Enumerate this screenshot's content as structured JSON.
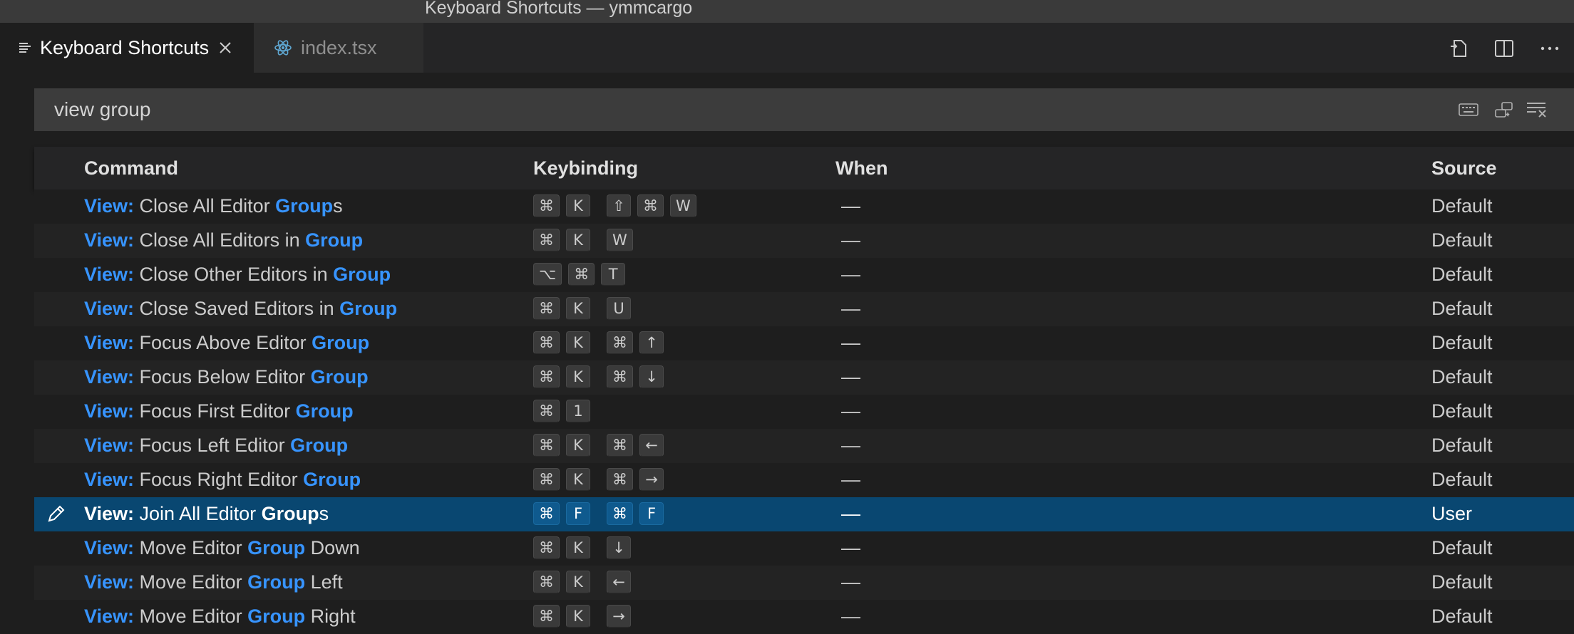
{
  "window": {
    "title": "Keyboard Shortcuts — ymmcargo"
  },
  "tabs": [
    {
      "label": "Keyboard Shortcuts",
      "active": true,
      "icon": "settings-list-icon"
    },
    {
      "label": "index.tsx",
      "active": false,
      "icon": "react-icon"
    }
  ],
  "toolbar_icons": [
    "open-keybindings-json-icon",
    "split-editor-icon",
    "more-actions-icon"
  ],
  "search": {
    "value": "view group",
    "actions": [
      "record-keys-icon",
      "sort-by-precedence-icon",
      "clear-input-icon"
    ]
  },
  "table": {
    "headers": {
      "command": "Command",
      "keybinding": "Keybinding",
      "when": "When",
      "source": "Source"
    },
    "rows": [
      {
        "prefix": "View:",
        "before": " Close All Editor ",
        "match": "Group",
        "after": "s",
        "keys": [
          [
            "⌘",
            "K"
          ],
          [
            "⇧",
            "⌘",
            "W"
          ]
        ],
        "when": "—",
        "source": "Default"
      },
      {
        "prefix": "View:",
        "before": " Close All Editors in ",
        "match": "Group",
        "after": "",
        "keys": [
          [
            "⌘",
            "K"
          ],
          [
            "W"
          ]
        ],
        "when": "—",
        "source": "Default"
      },
      {
        "prefix": "View:",
        "before": " Close Other Editors in ",
        "match": "Group",
        "after": "",
        "keys": [
          [
            "⌥",
            "⌘",
            "T"
          ]
        ],
        "when": "—",
        "source": "Default"
      },
      {
        "prefix": "View:",
        "before": " Close Saved Editors in ",
        "match": "Group",
        "after": "",
        "keys": [
          [
            "⌘",
            "K"
          ],
          [
            "U"
          ]
        ],
        "when": "—",
        "source": "Default"
      },
      {
        "prefix": "View:",
        "before": " Focus Above Editor ",
        "match": "Group",
        "after": "",
        "keys": [
          [
            "⌘",
            "K"
          ],
          [
            "⌘",
            "↑"
          ]
        ],
        "when": "—",
        "source": "Default"
      },
      {
        "prefix": "View:",
        "before": " Focus Below Editor ",
        "match": "Group",
        "after": "",
        "keys": [
          [
            "⌘",
            "K"
          ],
          [
            "⌘",
            "↓"
          ]
        ],
        "when": "—",
        "source": "Default"
      },
      {
        "prefix": "View:",
        "before": " Focus First Editor ",
        "match": "Group",
        "after": "",
        "keys": [
          [
            "⌘",
            "1"
          ]
        ],
        "when": "—",
        "source": "Default"
      },
      {
        "prefix": "View:",
        "before": " Focus Left Editor ",
        "match": "Group",
        "after": "",
        "keys": [
          [
            "⌘",
            "K"
          ],
          [
            "⌘",
            "←"
          ]
        ],
        "when": "—",
        "source": "Default"
      },
      {
        "prefix": "View:",
        "before": " Focus Right Editor ",
        "match": "Group",
        "after": "",
        "keys": [
          [
            "⌘",
            "K"
          ],
          [
            "⌘",
            "→"
          ]
        ],
        "when": "—",
        "source": "Default"
      },
      {
        "prefix": "View:",
        "before": " Join All Editor ",
        "match": "Group",
        "after": "s",
        "keys": [
          [
            "⌘",
            "F"
          ],
          [
            "⌘",
            "F"
          ]
        ],
        "when": "—",
        "source": "User",
        "selected": true
      },
      {
        "prefix": "View:",
        "before": " Move Editor ",
        "match": "Group",
        "after": " Down",
        "keys": [
          [
            "⌘",
            "K"
          ],
          [
            "↓"
          ]
        ],
        "when": "—",
        "source": "Default"
      },
      {
        "prefix": "View:",
        "before": " Move Editor ",
        "match": "Group",
        "after": " Left",
        "keys": [
          [
            "⌘",
            "K"
          ],
          [
            "←"
          ]
        ],
        "when": "—",
        "source": "Default"
      },
      {
        "prefix": "View:",
        "before": " Move Editor ",
        "match": "Group",
        "after": " Right",
        "keys": [
          [
            "⌘",
            "K"
          ],
          [
            "→"
          ]
        ],
        "when": "—",
        "source": "Default"
      }
    ]
  },
  "colors": {
    "accent": "#3794ff",
    "selection": "#094771",
    "background": "#1e1e1e"
  }
}
